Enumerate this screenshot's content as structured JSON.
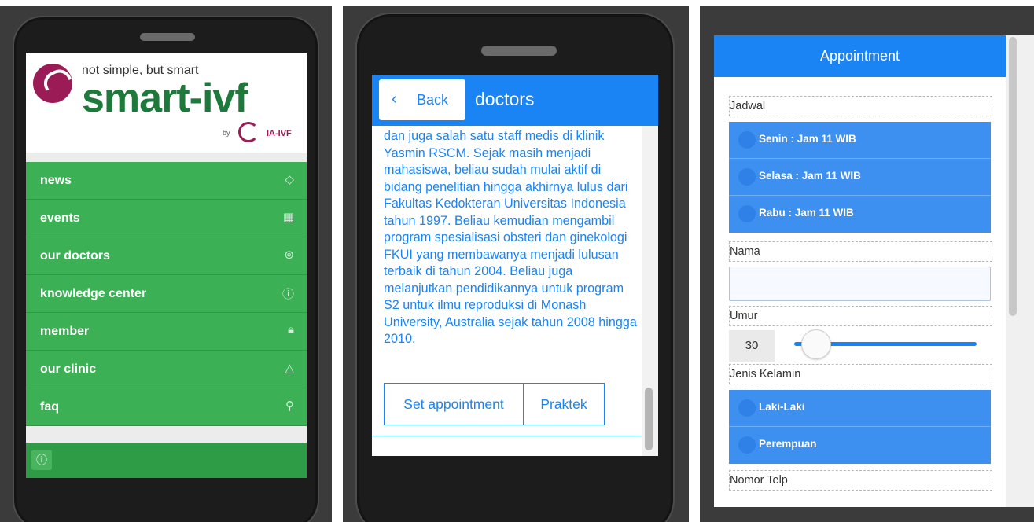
{
  "panel1": {
    "logo": {
      "tagline": "not simple, but smart",
      "brand": "smart-ivf",
      "by": "by",
      "partner": "IA-IVF"
    },
    "menu": [
      {
        "label": "news",
        "icon": "tag-icon",
        "glyph": "◇"
      },
      {
        "label": "events",
        "icon": "calendar-icon",
        "glyph": "▦"
      },
      {
        "label": "our doctors",
        "icon": "doctor-icon",
        "glyph": "⊚"
      },
      {
        "label": "knowledge center",
        "icon": "info-icon",
        "glyph": "ⓘ"
      },
      {
        "label": "member",
        "icon": "lock-icon",
        "glyph": "🔒︎"
      },
      {
        "label": "our clinic",
        "icon": "triangle-icon",
        "glyph": "△"
      },
      {
        "label": "faq",
        "icon": "search-icon",
        "glyph": "⚲"
      }
    ],
    "footer_icon": "ⓘ"
  },
  "panel2": {
    "back_label": "Back",
    "back_chevron": "‹",
    "title": "doctors",
    "bio": "dan juga salah satu staff medis di klinik Yasmin RSCM. Sejak masih menjadi mahasiswa, beliau sudah mulai aktif di bidang penelitian hingga akhirnya lulus dari Fakultas Kedokteran Universitas Indonesia tahun 1997. Beliau kemudian mengambil program spesialisasi obsteri dan ginekologi FKUI yang membawanya menjadi lulusan terbaik di tahun 2004. Beliau juga melanjutkan pendidikannya untuk program S2 untuk ilmu reproduksi di Monash University, Australia sejak tahun 2008 hingga 2010.",
    "buttons": {
      "appointment": "Set appointment",
      "practice": "Praktek"
    }
  },
  "panel3": {
    "title": "Appointment",
    "fields": {
      "jadwal": "Jadwal",
      "nama": "Nama",
      "umur": "Umur",
      "jenis_kelamin": "Jenis Kelamin",
      "nomor_telp": "Nomor Telp"
    },
    "jadwal_options": [
      "Senin : Jam 11 WIB",
      "Selasa : Jam 11 WIB",
      "Rabu : Jam 11 WIB"
    ],
    "gender_options": [
      "Laki-Laki",
      "Perempuan"
    ],
    "age_value": "30",
    "colors": {
      "accent": "#1a84f4",
      "menu_green": "#3cb054"
    }
  }
}
